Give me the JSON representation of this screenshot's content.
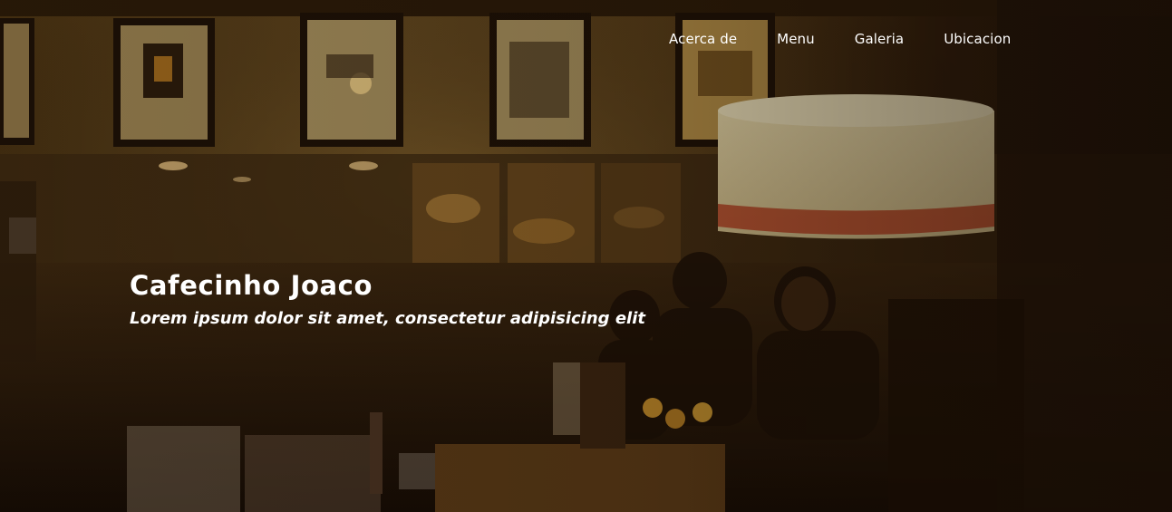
{
  "page": {
    "background_description_icon": "coffee-shop-photo",
    "overlay_color": "#1a0e06"
  },
  "nav": {
    "items": [
      {
        "label": "Acerca de"
      },
      {
        "label": "Menu"
      },
      {
        "label": "Galeria"
      },
      {
        "label": "Ubicacion"
      }
    ]
  },
  "hero": {
    "title": "Cafecinho Joaco",
    "subtitle": "Lorem ipsum dolor sit amet, consectetur adipisicing elit"
  }
}
